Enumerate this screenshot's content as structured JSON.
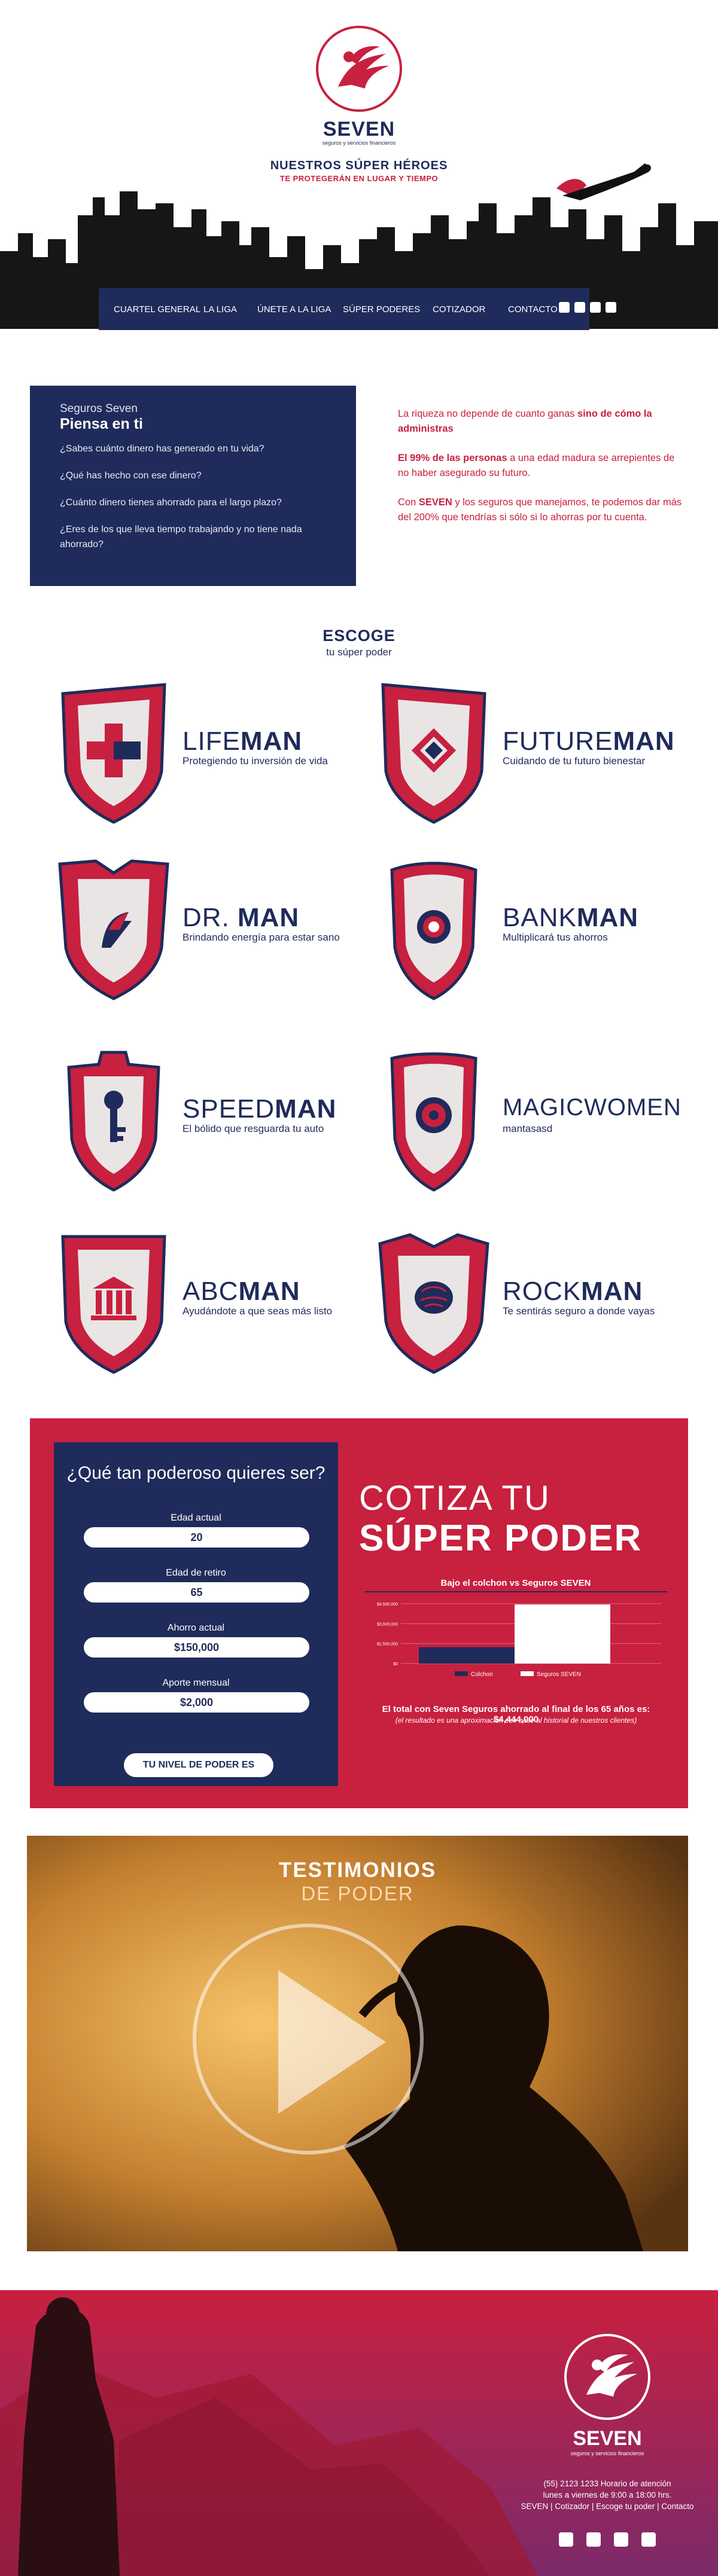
{
  "brand": {
    "name": "SEVEN",
    "tagline": "seguros y servicios financieros"
  },
  "hero": {
    "title": "NUESTROS SÚPER HÉROES",
    "subtitle": "TE PROTEGERÁN  EN LUGAR Y TIEMPO"
  },
  "nav": {
    "items": [
      "CUARTEL GENERAL",
      "LA LIGA",
      "ÚNETE A LA LIGA",
      "SÚPER PODERES",
      "COTIZADOR",
      "CONTACTO"
    ],
    "social": [
      "facebook-icon",
      "instagram-icon",
      "twitter-icon",
      "youtube-icon"
    ]
  },
  "piensa": {
    "kicker": "Seguros Seven",
    "title": "Piensa en ti",
    "questions": [
      "¿Sabes cuánto dinero has generado en tu vida?",
      "¿Qué has hecho con ese dinero?",
      "¿Cuánto dinero tienes ahorrado para el largo plazo?",
      "¿Eres de los que lleva tiempo trabajando y no tiene nada ahorrado?"
    ]
  },
  "wealth": {
    "p1_a": "La riqueza no depende de cuanto ganas ",
    "p1_b": "sino de cómo la administras",
    "p2_a": "El 99% de las personas",
    "p2_b": " a una edad madura se arrepientes de no haber asegurado su futuro.",
    "p3_a": "Con ",
    "p3_b": "SEVEN",
    "p3_c": " y los seguros que manejamos,  te podemos dar más del 200% que tendrías si sólo si lo ahorras por tu cuenta."
  },
  "escoge": {
    "title": "ESCOGE",
    "subtitle": "tu súper poder"
  },
  "heroes": [
    {
      "a": "LIFE",
      "b": "MAN",
      "desc": "Protegiendo tu inversión de vida"
    },
    {
      "a": "FUTURE",
      "b": "MAN",
      "desc": "Cuidando de tu futuro bienestar"
    },
    {
      "a": "DR. ",
      "b": "MAN",
      "desc": "Brindando energía para estar sano"
    },
    {
      "a": "BANK",
      "b": "MAN",
      "desc": "Multiplicará tus ahorros"
    },
    {
      "a": "SPEED",
      "b": "MAN",
      "desc": "El bólido que resguarda tu auto"
    },
    {
      "a": "MAGICWOMEN",
      "b": "",
      "desc": "mantasasd"
    },
    {
      "a": "ABC",
      "b": "MAN",
      "desc": "Ayudándote a que seas más listo"
    },
    {
      "a": "ROCK",
      "b": "MAN",
      "desc": "Te sentirás seguro a donde vayas"
    }
  ],
  "cotiza": {
    "form_title": "¿Qué tan poderoso quieres ser?",
    "fields": [
      {
        "label": "Edad actual",
        "value": "20"
      },
      {
        "label": "Edad de retiro",
        "value": "65"
      },
      {
        "label": "Ahorro actual",
        "value": "$150,000"
      },
      {
        "label": "Aporte mensual",
        "value": "$2,000"
      }
    ],
    "button": "TU NIVEL DE PODER ES",
    "heading1": "COTIZA TU",
    "heading2": "SÚPER PODER",
    "note": "El total con Seven Seguros ahorrado al final de los 65 años es: $4,444,000",
    "disclaimer": "(el resultado es una aproximación con base al historial de nuestros clientes)"
  },
  "chart_data": {
    "type": "bar",
    "title": "Bajo el colchon vs Seguros SEVEN",
    "yticks": [
      "$0",
      "$1,500,000",
      "$3,000,000",
      "$4,500,000"
    ],
    "ylim": [
      0,
      4500000
    ],
    "series": [
      {
        "name": "Colchon",
        "value": 1230000,
        "color": "#1f2b5a"
      },
      {
        "name": "Seguros SEVEN",
        "value": 4444000,
        "color": "#ffffff"
      }
    ],
    "grid": true,
    "legend": "bottom"
  },
  "testimonios": {
    "title": "TESTIMONIOS",
    "subtitle": "DE PODER"
  },
  "footer": {
    "line1": "(55) 2123 1233 Horario de atención",
    "line2": "lunes a viernes de 9:00 a 18:00 hrs.",
    "line3": "SEVEN | Cotizador | Escoge  tu poder | Contacto"
  },
  "colors": {
    "navy": "#1f2b5a",
    "crimson": "#c8203f"
  }
}
